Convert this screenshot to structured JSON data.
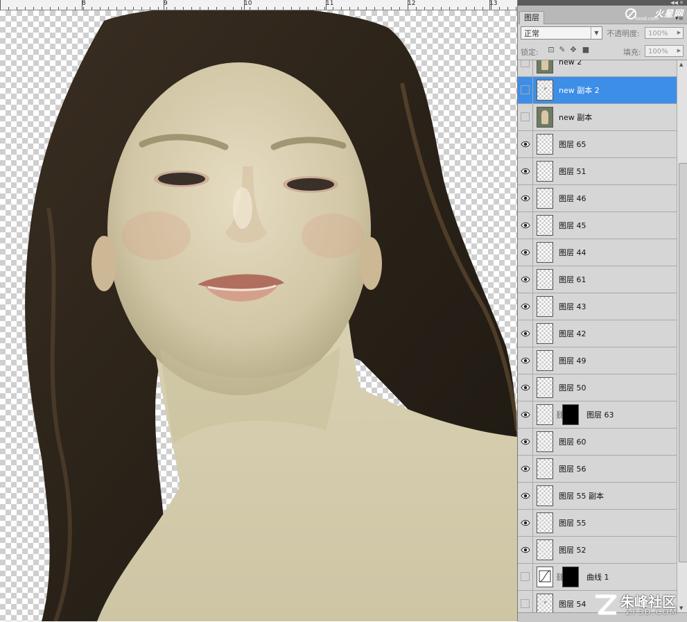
{
  "ruler": {
    "marks": [
      "8",
      "9",
      "10",
      "11",
      "12",
      "13"
    ]
  },
  "panel": {
    "tab_label": "图层",
    "logo_text": "火星网",
    "logo_sub": "hxsd.com",
    "blend_mode": "正常",
    "opacity_label": "不透明度:",
    "opacity_value": "100%",
    "lock_label": "锁定:",
    "fill_label": "填充:",
    "fill_value": "100%"
  },
  "layers": [
    {
      "name": "new 2",
      "visible": false,
      "selected": false,
      "thumb": "photo"
    },
    {
      "name": "new 副本 2",
      "visible": false,
      "selected": true,
      "thumb": "dot"
    },
    {
      "name": "new 副本",
      "visible": false,
      "selected": false,
      "thumb": "photo"
    },
    {
      "name": "图层 65",
      "visible": true,
      "selected": false,
      "thumb": "transparent"
    },
    {
      "name": "图层 51",
      "visible": true,
      "selected": false,
      "thumb": "transparent"
    },
    {
      "name": "图层 46",
      "visible": true,
      "selected": false,
      "thumb": "transparent"
    },
    {
      "name": "图层 45",
      "visible": true,
      "selected": false,
      "thumb": "transparent"
    },
    {
      "name": "图层 44",
      "visible": true,
      "selected": false,
      "thumb": "transparent"
    },
    {
      "name": "图层 61",
      "visible": true,
      "selected": false,
      "thumb": "transparent"
    },
    {
      "name": "图层 43",
      "visible": true,
      "selected": false,
      "thumb": "transparent"
    },
    {
      "name": "图层 42",
      "visible": true,
      "selected": false,
      "thumb": "transparent"
    },
    {
      "name": "图层 49",
      "visible": true,
      "selected": false,
      "thumb": "transparent"
    },
    {
      "name": "图层 50",
      "visible": true,
      "selected": false,
      "thumb": "transparent"
    },
    {
      "name": "图层 63",
      "visible": true,
      "selected": false,
      "thumb": "transparent",
      "mask": true
    },
    {
      "name": "图层 60",
      "visible": true,
      "selected": false,
      "thumb": "transparent"
    },
    {
      "name": "图层 56",
      "visible": true,
      "selected": false,
      "thumb": "transparent"
    },
    {
      "name": "图层 55 副本",
      "visible": true,
      "selected": false,
      "thumb": "transparent"
    },
    {
      "name": "图层 55",
      "visible": true,
      "selected": false,
      "thumb": "transparent"
    },
    {
      "name": "图层 52",
      "visible": true,
      "selected": false,
      "thumb": "transparent"
    },
    {
      "name": "曲线 1",
      "visible": false,
      "selected": false,
      "thumb": "curve",
      "mask": true
    },
    {
      "name": "图层 54",
      "visible": false,
      "selected": false,
      "thumb": "dot"
    }
  ],
  "watermark": {
    "main": "朱峰社区",
    "sub": "ZF3D.COM"
  },
  "icons": [
    "eye-icon",
    "link-icon",
    "lock-icon",
    "brush-icon",
    "move-icon",
    "chevron-down-icon",
    "menu-icon"
  ]
}
